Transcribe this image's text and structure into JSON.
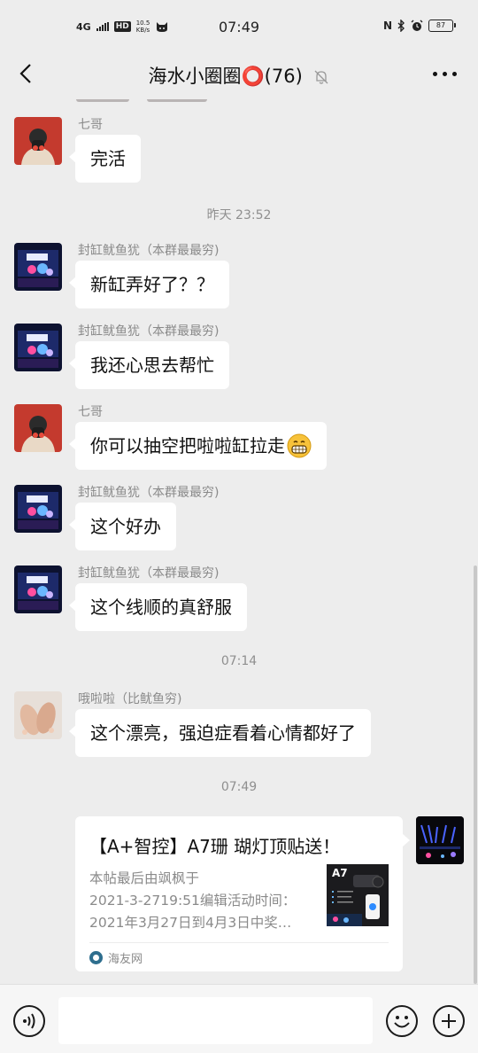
{
  "status_bar": {
    "network": "4G",
    "hd": "HD",
    "speed_value": "10.5",
    "speed_unit": "KB/s",
    "time": "07:49",
    "battery": "87",
    "nfc": "N"
  },
  "header": {
    "title": "海水小圈圈⭕(76)"
  },
  "messages": [
    {
      "sender": "七哥",
      "text": "完活"
    },
    {
      "sender": "封缸鱿鱼犹（本群最最穷)",
      "text": "新缸弄好了？？"
    },
    {
      "sender": "封缸鱿鱼犹（本群最最穷)",
      "text": "我还心思去帮忙"
    },
    {
      "sender": "七哥",
      "text": "你可以抽空把啦啦缸拉走"
    },
    {
      "sender": "封缸鱿鱼犹（本群最最穷)",
      "text": "这个好办"
    },
    {
      "sender": "封缸鱿鱼犹（本群最最穷)",
      "text": "这个线顺的真舒服"
    },
    {
      "sender": "哦啦啦（比鱿鱼穷)",
      "text": "这个漂亮，强迫症看着心情都好了"
    }
  ],
  "time_dividers": [
    "昨天 23:52",
    "07:14",
    "07:49"
  ],
  "link_card": {
    "title": "【A+智控】A7珊  瑚灯顶贴送！",
    "desc_lines": [
      "本帖最后由飒枫于",
      "2021-3-2719:51编辑活动时间：",
      "2021年3月27日到4月3日中奖…"
    ],
    "thumb_label": "A7",
    "source": "海友网"
  },
  "input": {
    "placeholder": ""
  }
}
